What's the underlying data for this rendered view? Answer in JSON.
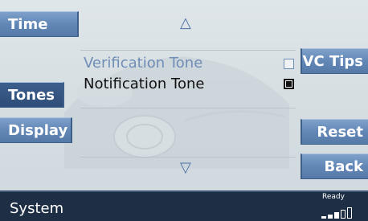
{
  "left_menu": {
    "time": "Time",
    "tones": "Tones",
    "display": "Display"
  },
  "right_menu": {
    "vc_tips": "VC Tips",
    "reset": "Reset",
    "back": "Back"
  },
  "options": [
    {
      "label": "Verification Tone",
      "checked": false,
      "style": "inactive"
    },
    {
      "label": "Notification Tone",
      "checked": true,
      "style": "active"
    }
  ],
  "status_bar": {
    "title": "System",
    "ready": "Ready",
    "signal_level": 0.6
  },
  "colors": {
    "button": "#6287b6",
    "status_bar": "#1e2f45",
    "inactive_text": "#6f8db5"
  },
  "icons": {
    "scroll_up": "up-triangle-icon",
    "scroll_down": "down-triangle-icon"
  },
  "glyphs": {
    "up": "△",
    "down": "▽"
  }
}
